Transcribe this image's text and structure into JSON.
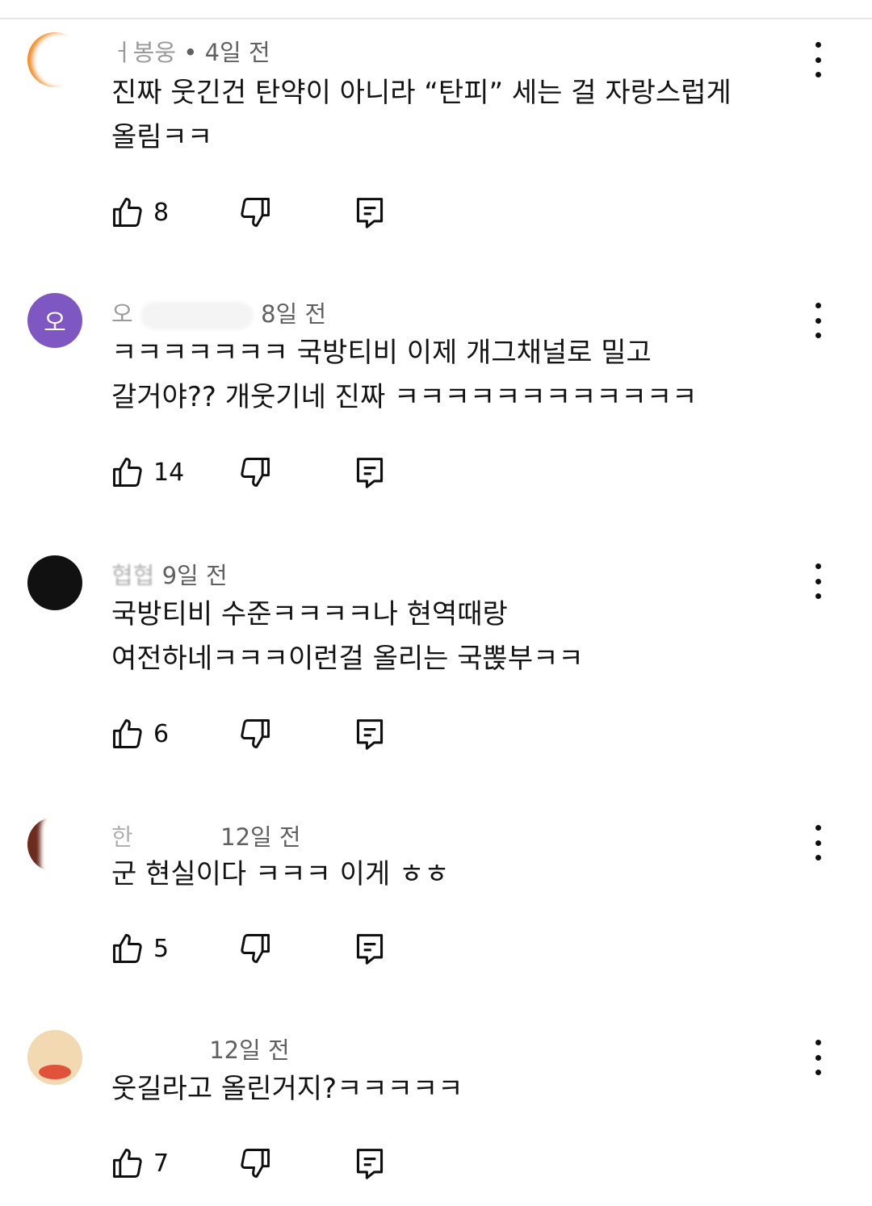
{
  "comments": [
    {
      "author_visible": "ㅓ봉웅",
      "time": "• 4일 전",
      "text": "진짜 웃긴건 탄약이 아니라 “탄피” 세는 걸 자랑스럽게\n올림ㅋㅋ",
      "likes": "8",
      "avatar_color": "#f28c28"
    },
    {
      "author_visible": "오",
      "time": "8일 전",
      "text": "ㅋㅋㅋㅋㅋㅋㅋ 국방티비 이제 개그채널로 밀고\n갈거야?? 개웃기네 진짜 ㅋㅋㅋㅋㅋㅋㅋㅋㅋㅋㅋㅋ",
      "likes": "14",
      "avatar_letter": "오",
      "avatar_color": "#7e57c2"
    },
    {
      "author_visible": "협협",
      "time": "9일 전",
      "text": "국방티비 수준ㅋㅋㅋㅋ나 현역때랑\n여전하네ㅋㅋㅋ이런걸 올리는 국뽅부ㅋㅋ",
      "likes": "6",
      "avatar_color": "#111111"
    },
    {
      "author_visible": "한",
      "time": "12일 전",
      "text": "군 현실이다 ㅋㅋㅋ        이게 ㅎㅎ",
      "likes": "5",
      "avatar_color": "#6b2b1d"
    },
    {
      "author_visible": "",
      "time": "12일 전",
      "text": "웃길라고 올린거지?ㅋㅋㅋㅋㅋ",
      "likes": "7",
      "avatar_color": "#f3d9b1"
    }
  ],
  "icons": {
    "like": "thumbs-up-icon",
    "dislike": "thumbs-down-icon",
    "reply": "reply-icon",
    "more": "more-vertical-icon"
  }
}
